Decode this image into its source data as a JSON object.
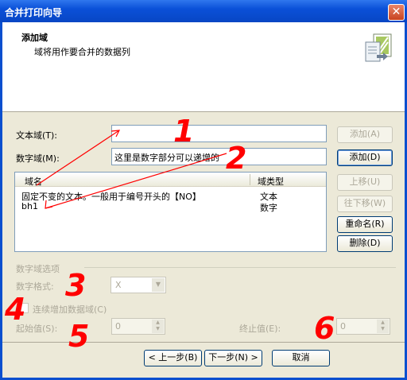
{
  "window": {
    "title": "合并打印向导",
    "close_icon": "close-icon"
  },
  "header": {
    "title": "添加域",
    "subtitle": "域将用作要合并的数据列",
    "icon": "wizard-icon"
  },
  "fields": {
    "text_field_label": "文本域(T):",
    "text_field_value": "",
    "number_field_label": "数字域(M):",
    "number_field_value": "这里是数字部分可以递增的"
  },
  "buttons": {
    "add_text": "添加(A)",
    "add_number": "添加(D)",
    "move_up": "上移(U)",
    "move_down": "往下移(W)",
    "rename": "重命名(R)",
    "delete": "删除(D)",
    "prev": "< 上一步(B)",
    "next": "下一步(N) >",
    "cancel": "取消"
  },
  "list": {
    "columns": [
      "域名",
      "域类型"
    ],
    "rows": [
      {
        "name": "固定不变的文本。一般用于编号开头的【NO】",
        "type": "文本"
      },
      {
        "name": "bh1",
        "type": "数字"
      }
    ]
  },
  "options": {
    "group_label": "数字域选项",
    "format_label": "数字格式:",
    "format_value": "X",
    "increment_label": "连续增加数据域(C)",
    "start_label": "起始值(S):",
    "start_value": "0",
    "end_label": "终止值(E):",
    "end_value": "0"
  },
  "annotations": {
    "n1": "1",
    "n2": "2",
    "n3": "3",
    "n4": "4",
    "n5": "5",
    "n6": "6",
    "color": "#ff0000"
  }
}
